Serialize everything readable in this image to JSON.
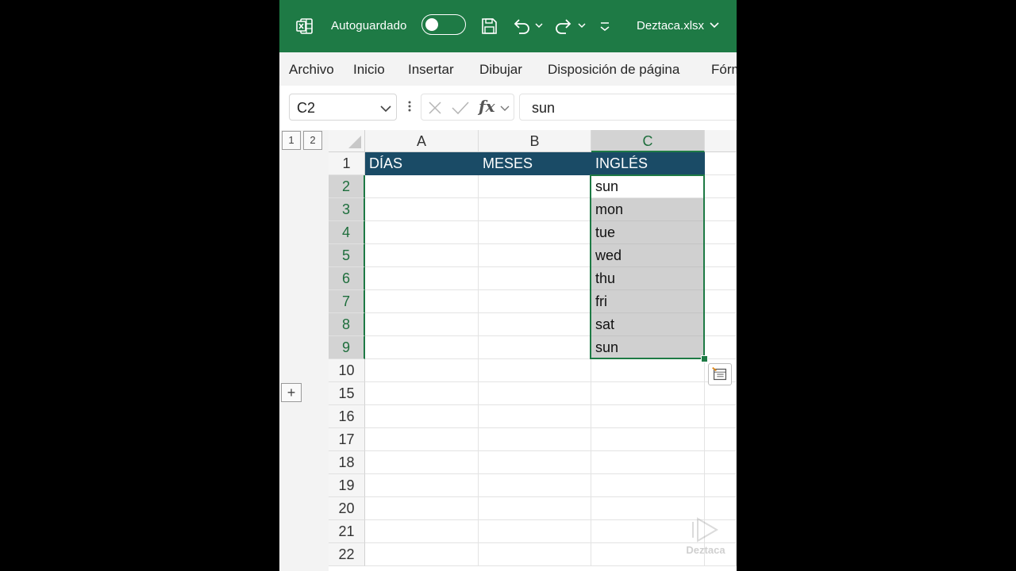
{
  "titlebar": {
    "autosave_label": "Autoguardado",
    "autosave_on": false,
    "filename": "Deztaca.xlsx",
    "bg_color": "#1e7a45"
  },
  "ribbon": {
    "tabs": [
      "Archivo",
      "Inicio",
      "Insertar",
      "Dibujar",
      "Disposición de página",
      "Fórm"
    ]
  },
  "formula_bar": {
    "name_box": "C2",
    "fx_label": "fx",
    "formula_value": "sun"
  },
  "outline": {
    "levels": [
      "1",
      "2"
    ],
    "expand_symbol": "+"
  },
  "grid": {
    "columns": [
      "A",
      "B",
      "C"
    ],
    "selected_column": "C",
    "rows": [
      {
        "num": "1",
        "A": "DÍAS",
        "B": "MESES",
        "C": "INGLÉS"
      },
      {
        "num": "2",
        "A": "",
        "B": "",
        "C": "sun"
      },
      {
        "num": "3",
        "A": "",
        "B": "",
        "C": "mon"
      },
      {
        "num": "4",
        "A": "",
        "B": "",
        "C": "tue"
      },
      {
        "num": "5",
        "A": "",
        "B": "",
        "C": "wed"
      },
      {
        "num": "6",
        "A": "",
        "B": "",
        "C": "thu"
      },
      {
        "num": "7",
        "A": "",
        "B": "",
        "C": "fri"
      },
      {
        "num": "8",
        "A": "",
        "B": "",
        "C": "sat"
      },
      {
        "num": "9",
        "A": "",
        "B": "",
        "C": "sun"
      },
      {
        "num": "10",
        "A": "",
        "B": "",
        "C": ""
      },
      {
        "num": "15",
        "A": "",
        "B": "",
        "C": ""
      },
      {
        "num": "16",
        "A": "",
        "B": "",
        "C": ""
      },
      {
        "num": "17",
        "A": "",
        "B": "",
        "C": ""
      },
      {
        "num": "18",
        "A": "",
        "B": "",
        "C": ""
      },
      {
        "num": "19",
        "A": "",
        "B": "",
        "C": ""
      },
      {
        "num": "20",
        "A": "",
        "B": "",
        "C": ""
      },
      {
        "num": "21",
        "A": "",
        "B": "",
        "C": ""
      },
      {
        "num": "22",
        "A": "",
        "B": "",
        "C": ""
      }
    ],
    "header_fill_color": "#1a4b66"
  },
  "watermark": {
    "text": "Deztaca"
  }
}
